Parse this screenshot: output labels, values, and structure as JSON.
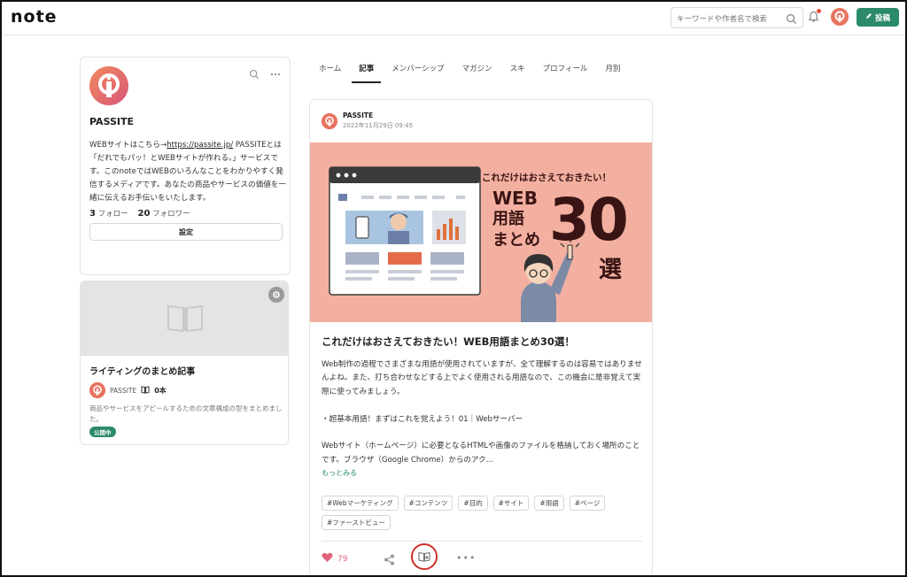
{
  "header": {
    "logo": "note",
    "search_placeholder": "キーワードや作者名で検索",
    "post_label": "投稿"
  },
  "profile": {
    "name": "PASSITE",
    "bio_prefix": "WEBサイトはこちら→",
    "bio_link": "https://passite.jp/",
    "bio_rest": " PASSITEとは「だれでもパッ！とWEBサイトが作れる。」サービスです。このnoteではWEBのいろんなことをわかりやすく発信するメディアです。あなたの商品やサービスの価値を一緒に伝えるお手伝いをいたします。",
    "follow_count": "3",
    "follow_label": "フォロー",
    "follower_count": "20",
    "follower_label": "フォロワー",
    "settings_label": "設定"
  },
  "magazine": {
    "title": "ライティングのまとめ記事",
    "author": "PASSITE",
    "count": "0本",
    "description": "商品やサービスをアピールするための文章構成の型をまとめました。",
    "status": "公開中"
  },
  "tabs": [
    {
      "label": "ホーム"
    },
    {
      "label": "記事"
    },
    {
      "label": "メンバーシップ"
    },
    {
      "label": "マガジン"
    },
    {
      "label": "スキ"
    },
    {
      "label": "プロフィール"
    },
    {
      "label": "月別"
    }
  ],
  "article": {
    "author": "PASSITE",
    "date": "2022年11月29日 09:45",
    "banner": {
      "headline": "これだけはおさえておきたい！",
      "line1": "WEB",
      "line2": "用語",
      "line3": "まとめ",
      "number": "30",
      "suffix": "選"
    },
    "title": "これだけはおさえておきたい！WEB用語まとめ30選！",
    "paragraphs": [
      "Web制作の過程でさまざまな用語が使用されていますが、全て理解するのは容易ではありませんよね。また、打ち合わせなどする上でよく使用される用語なので、この機会に是非覚えて実際に使ってみましょう。",
      "・超基本用語！まずはこれを覚えよう！01｜Webサーバー",
      "Webサイト（ホームページ）に必要となるHTMLや画像のファイルを格納しておく場所のことです。ブラウザ（Google Chrome）からのアク..."
    ],
    "more_label": "もっとみる",
    "tags": [
      "#Webマーケティング",
      "#コンテンツ",
      "#目的",
      "#サイト",
      "#用語",
      "#ページ",
      "#ファーストビュー"
    ],
    "likes": "79"
  },
  "colors": {
    "accent": "#2b8a6a",
    "like": "#e0637a",
    "avatar": "#e8735f",
    "banner_bg": "#f3b0a0",
    "highlight_circle": "#d0302a"
  }
}
